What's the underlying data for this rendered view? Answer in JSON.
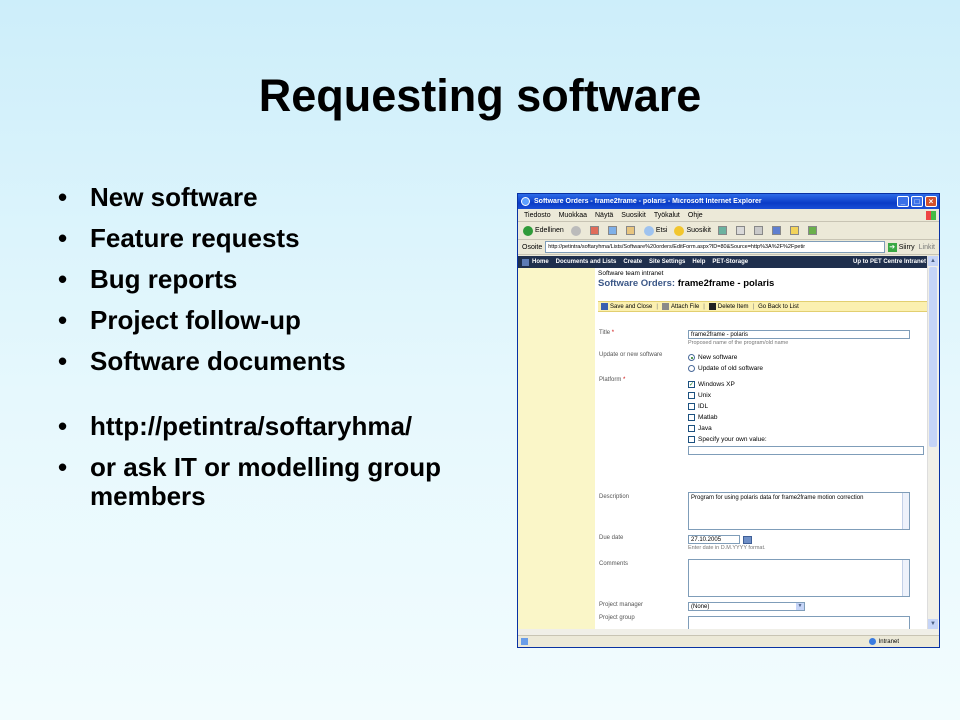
{
  "slide": {
    "title": "Requesting software",
    "bullets": [
      "New software",
      "Feature requests",
      "Bug reports",
      "Project follow-up",
      "Software documents"
    ],
    "bullets2": [
      "http://petintra/softaryhma/",
      "or ask IT or modelling group members"
    ],
    "bullet_glyph": "•"
  },
  "browser": {
    "title": "Software Orders - frame2frame - polaris - Microsoft Internet Explorer",
    "menu": [
      "Tiedosto",
      "Muokkaa",
      "Näytä",
      "Suosikit",
      "Työkalut",
      "Ohje"
    ],
    "toolbar": {
      "back": "Edellinen",
      "search": "Etsi",
      "favorites": "Suosikit"
    },
    "address_label": "Osoite",
    "address": "http://petintra/softaryhma/Lists/Software%20orders/EditForm.aspx?ID=80&Source=http%3A%2F%2Fpetir",
    "go": "Siirry",
    "links": "Linkit",
    "status_zone": "Intranet",
    "win_min": "_",
    "win_max": "□",
    "win_close": "×"
  },
  "sharepoint": {
    "nav": [
      "Home",
      "Documents and Lists",
      "Create",
      "Site Settings",
      "Help",
      "PET-Storage"
    ],
    "nav_right": "Up to PET Centre Intranet",
    "site": "Software team intranet",
    "list_title": "Software Orders:",
    "item_title": "frame2frame - polaris",
    "tools": {
      "save": "Save and Close",
      "attach": "Attach File",
      "delete": "Delete Item",
      "back": "Go Back to List"
    },
    "form": {
      "title_label": "Title",
      "title_value": "frame2frame - polaris",
      "title_hint": "Proposed name of the program/old name",
      "update_label": "Update or new software",
      "update_options": [
        "New software",
        "Update of old software"
      ],
      "platform_label": "Platform",
      "platform_options": [
        "Windows XP",
        "Unix",
        "IDL",
        "Matlab",
        "Java",
        "Specify your own value:"
      ],
      "description_label": "Description",
      "description_value": "Program for using polaris data for frame2frame motion correction",
      "due_label": "Due date",
      "due_value": "27.10.2005",
      "due_hint": "Enter date in D.M.YYYY format.",
      "comments_label": "Comments",
      "manager_label": "Project manager",
      "manager_value": "(None)",
      "group_label": "Project group",
      "required_mark": "*"
    }
  }
}
